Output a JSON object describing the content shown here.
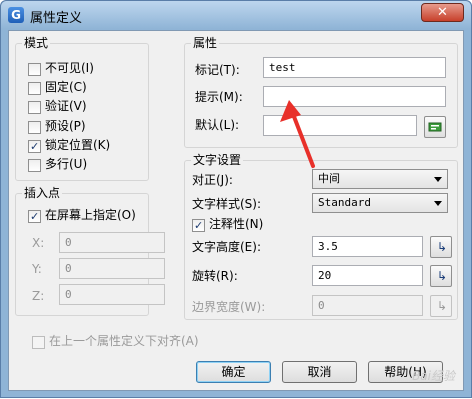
{
  "window": {
    "app_icon": "G",
    "title": "属性定义",
    "close_label": "✕"
  },
  "mode": {
    "title": "模式",
    "options": [
      {
        "label": "不可见(I)",
        "checked": false
      },
      {
        "label": "固定(C)",
        "checked": false
      },
      {
        "label": "验证(V)",
        "checked": false
      },
      {
        "label": "预设(P)",
        "checked": false
      },
      {
        "label": "锁定位置(K)",
        "checked": true
      },
      {
        "label": "多行(U)",
        "checked": false
      }
    ]
  },
  "insertion_point": {
    "title": "插入点",
    "specify_on_screen": {
      "label": "在屏幕上指定(O)",
      "checked": true
    },
    "x_label": "X:",
    "x_value": "0",
    "y_label": "Y:",
    "y_value": "0",
    "z_label": "Z:",
    "z_value": "0"
  },
  "attribute": {
    "title": "属性",
    "tag_label": "标记(T):",
    "tag_value": "test",
    "prompt_label": "提示(M):",
    "prompt_value": "",
    "default_label": "默认(L):",
    "default_value": "",
    "insert_field_icon": "insert-field-icon"
  },
  "text_settings": {
    "title": "文字设置",
    "justification_label": "对正(J):",
    "justification_value": "中间",
    "text_style_label": "文字样式(S):",
    "text_style_value": "Standard",
    "annotative": {
      "label": "注释性(N)",
      "checked": true
    },
    "text_height_label": "文字高度(E):",
    "text_height_value": "3.5",
    "rotation_label": "旋转(R):",
    "rotation_value": "20",
    "boundary_width_label": "边界宽度(W):",
    "boundary_width_value": "0"
  },
  "align_below": {
    "label": "在上一个属性定义下对齐(A)",
    "checked": false
  },
  "buttons": {
    "ok": "确定",
    "cancel": "取消",
    "help": "帮助(H)"
  },
  "annotation": {
    "arrow_color": "#e8302a"
  },
  "watermark": "Bai经验"
}
